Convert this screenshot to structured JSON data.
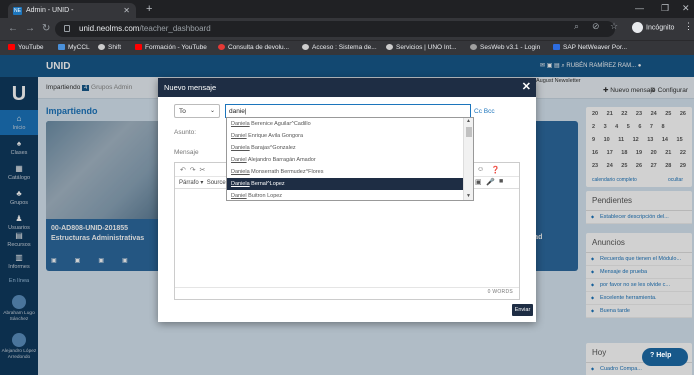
{
  "browser": {
    "tab_title": "Admin - UNID -",
    "tab_icon": "NE",
    "url_host": "unid.neolms.com",
    "url_path": "/teacher_dashboard",
    "profile": "Incógnito",
    "bookmarks": [
      {
        "label": "YouTube",
        "color": "#ff0000"
      },
      {
        "label": "MyCCL",
        "color": "#4a90d9"
      },
      {
        "label": "Shift",
        "color": "#cccccc"
      },
      {
        "label": "Formación - YouTube",
        "color": "#ff0000"
      },
      {
        "label": "Consulta de devolu...",
        "color": "#e53935"
      },
      {
        "label": "Acceso : Sistema de...",
        "color": "#cccccc"
      },
      {
        "label": "Servicios | UNO Int...",
        "color": "#cccccc"
      },
      {
        "label": "SesWeb v3.1 - Login",
        "color": "#9e9e9e"
      },
      {
        "label": "SAP NetWeaver Por...",
        "color": "#2d6cdf"
      }
    ]
  },
  "app": {
    "brand": "UNID",
    "user": "RUBÉN RAMÍREZ RAM...",
    "sidebar": [
      {
        "label": "Inicio",
        "icon": "home-icon",
        "glyph": "⌂"
      },
      {
        "label": "Clases",
        "icon": "graduation-icon",
        "glyph": "♠"
      },
      {
        "label": "Catálogo",
        "icon": "grid-icon",
        "glyph": "▦"
      },
      {
        "label": "Grupos",
        "icon": "group-icon",
        "glyph": "♣"
      },
      {
        "label": "Usuarios",
        "icon": "user-icon",
        "glyph": "♟"
      },
      {
        "label": "Recursos",
        "icon": "resources-icon",
        "glyph": "▤"
      },
      {
        "label": "Informes",
        "icon": "chart-icon",
        "glyph": "▥"
      }
    ],
    "online_label": "En línea",
    "online_users": [
      "Abraham Lugo Sánchez",
      "Alejandro López Arredondo"
    ],
    "subbar": {
      "tab_label": "Impartiendo",
      "tab_count": "4",
      "groups": "Grupos",
      "admin": "Admin",
      "august": "August Newsletter",
      "new_message": "Nuevo mensaje",
      "configure": "Configurar"
    },
    "section_title": "Impartiendo",
    "course_name": "00-AD808-UNID-201855 Estructuras Administrativas",
    "course2_name": "idad",
    "calendar": {
      "rows": [
        "20 21 22 23 24 25 26",
        "2 3 4 5 6 7 8",
        "9 10 11 12 13 14 15",
        "16 17 18 19 20 21 22",
        "23 24 25 26 27 28 29"
      ],
      "link_left": "calendario completo",
      "link_right": "ocultar"
    },
    "pendientes": {
      "title": "Pendientes",
      "items": [
        "Establecer descripción del..."
      ]
    },
    "anuncios": {
      "title": "Anuncios",
      "items": [
        "Recuerda que tienen el Módulo...",
        "Mensaje de prueba",
        "por favor no se les olvide c...",
        "Excelente herramienta.",
        "Buena tarde"
      ]
    },
    "hoy": {
      "title": "Hoy",
      "item": "Cuadro Compa..."
    },
    "help": "Help"
  },
  "modal": {
    "title": "Nuevo mensaje",
    "to_label": "To",
    "to_value": "danie",
    "cc_bcc": "Cc Bcc",
    "subject_label": "Asunto:",
    "message_label": "Mensaje",
    "format_label": "Párrafo",
    "source_label": "Source",
    "word_count": "0 WORDS",
    "send_label": "Enviar",
    "suggestions": [
      {
        "match": "Daniela",
        "rest": " Berenice Aguilar^Cadillo"
      },
      {
        "match": "Daniel",
        "rest": " Enrique Avila Gongora"
      },
      {
        "match": "Daniela",
        "rest": " Barajas^Gonzalez"
      },
      {
        "match": "Daniel",
        "rest": " Alejandro Barragán Amador"
      },
      {
        "match": "Daniela",
        "rest": " Monserrath Bermudez^Flores"
      },
      {
        "match": "Daniela",
        "rest": " Bernal^Lopez"
      },
      {
        "match": "Daniel",
        "rest": " Buitron Lopez"
      }
    ],
    "selected_index": 5
  }
}
